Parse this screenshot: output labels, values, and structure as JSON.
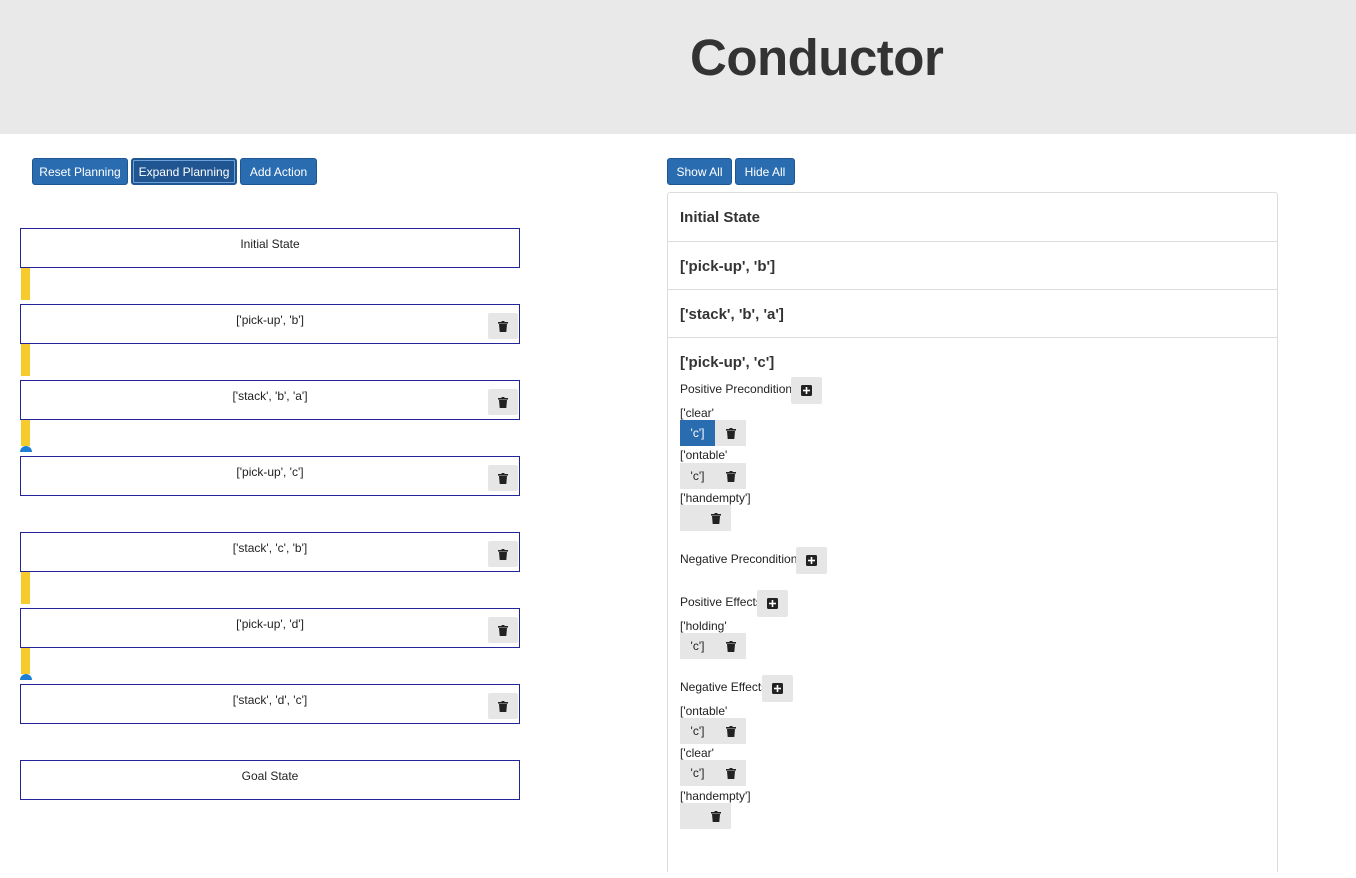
{
  "app": {
    "title": "Conductor"
  },
  "toolbar_left": {
    "reset": "Reset Planning",
    "expand": "Expand Planning",
    "add": "Add Action"
  },
  "toolbar_right": {
    "show": "Show All",
    "hide": "Hide All"
  },
  "plan": {
    "initial": "Initial State",
    "actions": [
      "['pick-up', 'b']",
      "['stack', 'b', 'a']",
      "['pick-up', 'c']",
      "['stack', 'c', 'b']",
      "['pick-up', 'd']",
      "['stack', 'd', 'c']"
    ],
    "goal": "Goal State"
  },
  "details": {
    "sections": [
      "Initial State",
      "['pick-up', 'b']",
      "['stack', 'b', 'a']",
      "['pick-up', 'c']"
    ],
    "expanded": {
      "pos_pre_label": "Positive Preconditions",
      "neg_pre_label": "Negative Preconditions",
      "pos_eff_label": "Positive Effects",
      "neg_eff_label": "Negative Effects",
      "pos_pre": [
        {
          "pred": "['clear'",
          "arg": "'c']"
        },
        {
          "pred": "['ontable'",
          "arg": "'c']"
        },
        {
          "pred": "['handempty']",
          "arg": ""
        }
      ],
      "pos_eff": [
        {
          "pred": "['holding'",
          "arg": "'c']"
        }
      ],
      "neg_eff": [
        {
          "pred": "['ontable'",
          "arg": "'c']"
        },
        {
          "pred": "['clear'",
          "arg": "'c']"
        },
        {
          "pred": "['handempty']",
          "arg": ""
        }
      ]
    }
  },
  "icons": {
    "delete": "trash-icon",
    "add": "plus-square-icon"
  },
  "colors": {
    "primary": "#2a6cb0",
    "link": "#f5cc2b",
    "node_border": "#23239a",
    "dot": "#1f7fd6"
  }
}
